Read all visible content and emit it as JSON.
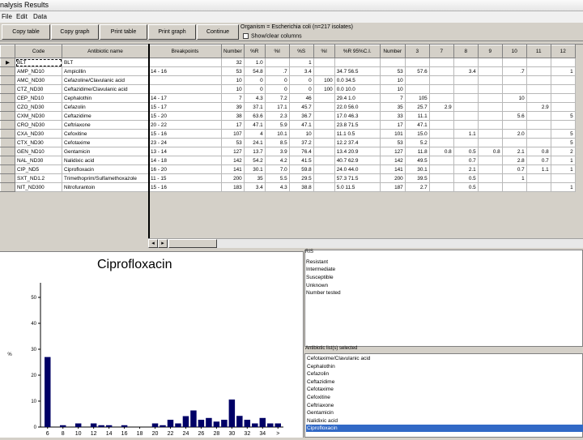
{
  "window": {
    "title": "nalysis Results"
  },
  "menu": [
    "File",
    "Edit",
    "Data"
  ],
  "toolbar": {
    "buttons": [
      "Copy table",
      "Copy graph",
      "Print table",
      "Print graph",
      "Continue"
    ],
    "organism": "Organism = Escherichia coli   (n=217 isolates)",
    "show_clear": "Show/clear columns"
  },
  "table": {
    "columns": [
      "Code",
      "Antibiotic name",
      "Breakpoints",
      "Number",
      "%R",
      "%I",
      "%S",
      "%I",
      "%R 95%C.I.",
      "Number",
      "3",
      "7",
      "8",
      "9",
      "10",
      "11",
      "12"
    ],
    "rows": [
      [
        "BLT",
        "BLT",
        "",
        "32",
        "1.0",
        "",
        "1",
        "",
        "",
        "",
        "",
        "",
        "",
        "",
        "",
        "",
        ""
      ],
      [
        "AMP_ND10",
        "Ampicillin",
        "14 - 16",
        "53",
        "54.8",
        ".7",
        "3.4",
        "",
        "34.7 56.5",
        "53",
        "57.6",
        "",
        "3.4",
        "",
        ".7",
        "",
        "1"
      ],
      [
        "AMC_ND30",
        "Cefazoline/Clavulanic acid",
        "",
        "10",
        "0",
        "0",
        "0",
        "100",
        "0.0 34.5",
        "10",
        "",
        "",
        "",
        "",
        "",
        "",
        ""
      ],
      [
        "CTZ_ND30",
        "Ceftazidime/Clavulanic acid",
        "",
        "10",
        "0",
        "0",
        "0",
        "100",
        "0.0 10.0",
        "10",
        "",
        "",
        "",
        "",
        "",
        "",
        ""
      ],
      [
        "CEP_ND10",
        "Cephalothin",
        "14 - 17",
        "7",
        "4.3",
        "7.2",
        "46",
        "",
        "29.4 1.0",
        "7",
        "105",
        "",
        "",
        "",
        "10",
        "",
        ""
      ],
      [
        "CZO_ND30",
        "Cefazolin",
        "15 - 17",
        "39",
        "37.1",
        "17.1",
        "45.7",
        "",
        "22.0 56.0",
        "35",
        "25.7",
        "2.9",
        "",
        "",
        "",
        "2.9",
        ""
      ],
      [
        "CXM_ND30",
        "Ceftazidime",
        "15 - 20",
        "38",
        "63.6",
        "2.3",
        "36.7",
        "",
        "17.0 46.3",
        "33",
        "11.1",
        "",
        "",
        "",
        "5.6",
        "",
        "5"
      ],
      [
        "CRO_ND30",
        "Ceftriaxone",
        "20 - 22",
        "17",
        "47.1",
        "5.9",
        "47.1",
        "",
        "23.8 71.5",
        "17",
        "47.1",
        "",
        "",
        "",
        "",
        "",
        ""
      ],
      [
        "CXA_ND30",
        "Cefoxitine",
        "15 - 16",
        "107",
        "4",
        "10.1",
        "10",
        "",
        "11.1 0.5",
        "101",
        "15.0",
        "",
        "1.1",
        "",
        "2.0",
        "",
        "5"
      ],
      [
        "CTX_ND30",
        "Cefotaxime",
        "23 - 24",
        "53",
        "24.1",
        "8.5",
        "37.2",
        "",
        "12.2 37.4",
        "53",
        "5.2",
        "",
        "",
        "",
        "",
        "",
        "5"
      ],
      [
        "GEN_ND10",
        "Gentamicin",
        "13 - 14",
        "127",
        "13.7",
        "3.9",
        "76.4",
        "",
        "13.4 20.9",
        "127",
        "11.8",
        "0.8",
        "0.5",
        "0.8",
        "2.1",
        "0.8",
        "2"
      ],
      [
        "NAL_ND30",
        "Nalidixic acid",
        "14 - 18",
        "142",
        "54.2",
        "4.2",
        "41.5",
        "",
        "40.7 62.9",
        "142",
        "49.5",
        "",
        "0.7",
        "",
        "2.8",
        "0.7",
        "1"
      ],
      [
        "CIP_ND5",
        "Ciprofloxacin",
        "16 - 20",
        "141",
        "30.1",
        "7.0",
        "59.8",
        "",
        "24.0 44.0",
        "141",
        "30.1",
        "",
        "2.1",
        "",
        "0.7",
        "1.1",
        "1"
      ],
      [
        "SXT_ND1.2",
        "Trimethoprim/Sulfamethoxazole",
        "11 - 15",
        "200",
        "35",
        "5.5",
        "29.5",
        "",
        "57.3 71.5",
        "200",
        "39.5",
        "",
        "0.5",
        "",
        "1",
        "",
        ""
      ],
      [
        "NIT_ND300",
        "Nitrofurantoin",
        "15 - 16",
        "183",
        "3.4",
        "4.3",
        "38.8",
        "",
        "5.0 11.5",
        "187",
        "2.7",
        "",
        "0.5",
        "",
        "",
        "",
        "1"
      ]
    ]
  },
  "chart": {
    "title": "Ciprofloxacin",
    "ylabel": "%",
    "chart_data": {
      "type": "bar",
      "title": "Ciprofloxacin",
      "ylabel": "%",
      "ylim": [
        0,
        55
      ],
      "yticks": [
        0,
        10,
        20,
        30,
        40,
        50
      ],
      "x_tick_labels": [
        "6",
        "8",
        "10",
        "12",
        "14",
        "16",
        "18",
        "20",
        "22",
        "24",
        "26",
        "28",
        "30",
        "32",
        "34",
        ">"
      ],
      "categories": [
        "6",
        "7",
        "8",
        "9",
        "10",
        "11",
        "12",
        "13",
        "14",
        "15",
        "16",
        "17",
        "18",
        "19",
        "20",
        "21",
        "22",
        "23",
        "24",
        "25",
        "26",
        "27",
        "28",
        "29",
        "30",
        "31",
        "32",
        "33",
        "34",
        "35",
        ">"
      ],
      "values": [
        27,
        0,
        0.7,
        0,
        1.4,
        0,
        1.4,
        0.7,
        0.7,
        0,
        0.7,
        0,
        0,
        0,
        1.4,
        0.7,
        2.8,
        1.4,
        4.2,
        6.4,
        2.8,
        3.5,
        2.1,
        2.8,
        10.6,
        4.3,
        2.8,
        1.4,
        3.5,
        1.4,
        1.4
      ]
    }
  },
  "pis": {
    "label": "RIS",
    "items": [
      "Resistant",
      "Intermediate",
      "Susceptible",
      "Unknown",
      "Number tested"
    ]
  },
  "antibiotic_list": {
    "label": "Antibiotic list(s) selected",
    "items": [
      "Cefotaxime/Clavulanic acid",
      "Cephalothin",
      "Cefazolin",
      "Ceftazidime",
      "Cefotaxime",
      "Cefoxitine",
      "Ceftriaxone",
      "Gentamicin",
      "Nalidixic acid",
      "Ciprofloxacin"
    ],
    "selected_index": 9
  }
}
